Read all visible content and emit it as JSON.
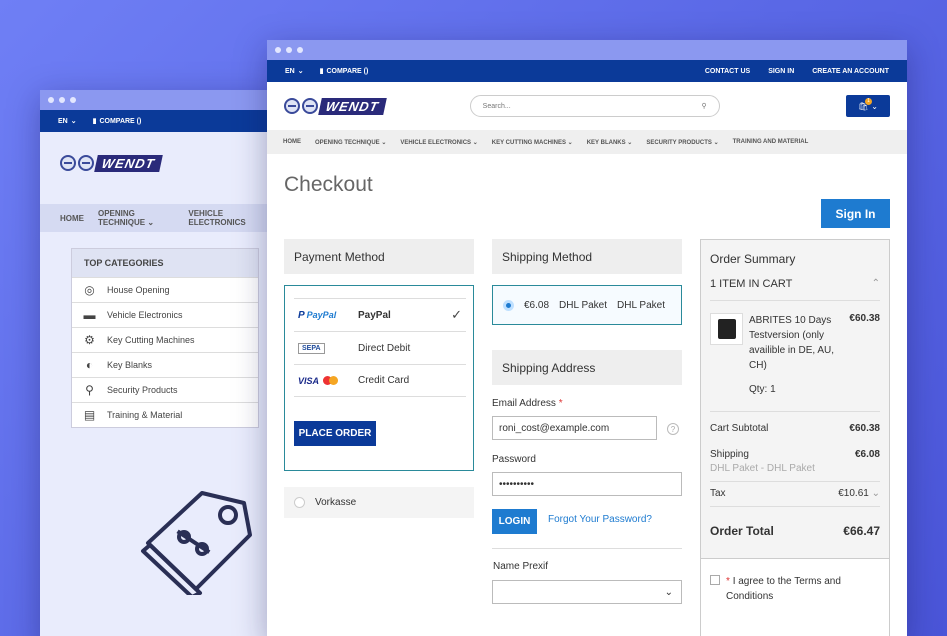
{
  "back": {
    "lang": "EN",
    "compare": "COMPARE ()",
    "logo": "WENDT",
    "nav": [
      "HOME",
      "OPENING TECHNIQUE",
      "VEHICLE ELECTRONICS"
    ],
    "categories_title": "TOP CATEGORIES",
    "categories": [
      {
        "label": "House Opening",
        "icon": "target-icon"
      },
      {
        "label": "Vehicle Electronics",
        "icon": "truck-icon"
      },
      {
        "label": "Key Cutting Machines",
        "icon": "gear-icon"
      },
      {
        "label": "Key Blanks",
        "icon": "half-circle-icon"
      },
      {
        "label": "Security Products",
        "icon": "search-icon"
      },
      {
        "label": "Training & Material",
        "icon": "document-icon"
      }
    ]
  },
  "front": {
    "lang": "EN",
    "compare": "COMPARE ()",
    "top_links": [
      "CONTACT US",
      "SIGN IN",
      "CREATE AN ACCOUNT"
    ],
    "logo": "WENDT",
    "search_placeholder": "Search...",
    "cart_count": "1",
    "nav": [
      "HOME",
      "OPENING TECHNIQUE",
      "VEHICLE ELECTRONICS",
      "KEY CUTTING MACHINES",
      "KEY BLANKS",
      "SECURITY PRODUCTS",
      "TRAINING AND MATERIAL"
    ],
    "title": "Checkout",
    "sign_in": "Sign In",
    "payment": {
      "heading": "Payment Method",
      "methods": [
        {
          "logo": "PayPal",
          "label": "PayPal",
          "selected": true
        },
        {
          "logo": "SEPA",
          "label": "Direct Debit"
        },
        {
          "logo": "VISA",
          "label": "Credit Card"
        }
      ],
      "place_order": "PLACE ORDER",
      "other": "Vorkasse"
    },
    "shipping": {
      "heading": "Shipping Method",
      "price": "€6.08",
      "carrier": "DHL Paket",
      "method": "DHL Paket"
    },
    "address": {
      "heading": "Shipping Address",
      "email_label": "Email Address",
      "required_mark": "*",
      "email_value": "roni_cost@example.com",
      "password_label": "Password",
      "password_value": "••••••••••",
      "login": "LOGIN",
      "forgot": "Forgot Your Password?",
      "name_prefix_label": "Name Prexif",
      "help": "?"
    },
    "summary": {
      "heading": "Order Summary",
      "items_in_cart": "1 ITEM IN CART",
      "item": {
        "name": "ABRITES 10 Days Testversion (only availible in DE, AU, CH)",
        "price": "€60.38",
        "qty": "Qty:  1"
      },
      "subtotal_label": "Cart Subtotal",
      "subtotal": "€60.38",
      "shipping_label": "Shipping",
      "shipping_detail": "DHL Paket - DHL Paket",
      "shipping": "€6.08",
      "tax_label": "Tax",
      "tax": "€10.61",
      "total_label": "Order Total",
      "total": "€66.47",
      "terms_mark": "*",
      "terms": "I agree to the Terms and Conditions"
    }
  },
  "colors": {
    "brand": "#0b3a99",
    "accent": "#1e7bd0",
    "border": "#2a8a9a"
  }
}
